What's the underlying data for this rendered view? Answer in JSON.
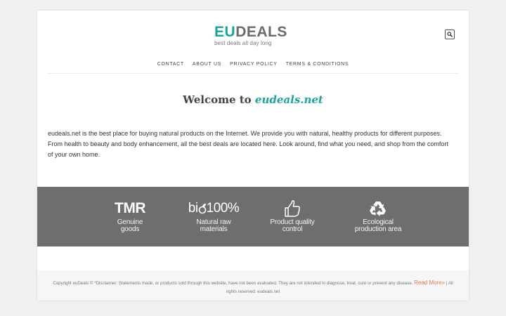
{
  "header": {
    "logo_prefix": "EU",
    "logo_suffix": "DEALS",
    "tagline": "best deals all day long",
    "search_icon": "search-icon"
  },
  "nav": {
    "items": [
      {
        "label": "CONTACT"
      },
      {
        "label": "ABOUT US"
      },
      {
        "label": "PRIVACY POLICY"
      },
      {
        "label": "TERMS & CONDITIONS"
      }
    ]
  },
  "main": {
    "welcome_prefix": "Welcome to",
    "welcome_brand": "eudeals.net",
    "intro": "eudeals.net is the best place for buying natural products on the Internet. We provide you with natural, healthy products for different purposes. From health to beauty and body enhancement, all the best deals are located here. Look around, find what you need, and shop from the comfort of your own home."
  },
  "features": [
    {
      "icon": "tmr-icon",
      "mark": "TMR",
      "line1": "Genuine",
      "line2": "goods"
    },
    {
      "icon": "bio-100-icon",
      "mark_a": "bi",
      "mark_b": "100%",
      "line1": "Natural raw",
      "line2": "materials"
    },
    {
      "icon": "thumbs-up-icon",
      "line1": "Product quality",
      "line2": "control"
    },
    {
      "icon": "recycle-icon",
      "line1": "Ecological",
      "line2": "production area"
    }
  ],
  "footer": {
    "copyright": "Copyright euDeals © *Disclaimer: Statements made, or products sold through this website, have not been evaluated. They are not intended to diagnose, treat, cure or prevent any disease.",
    "read_more": "Read More»",
    "rights": "| All rights reserved: eudeals.net"
  },
  "colors": {
    "accent": "#1aa59a",
    "logo_gray": "#6b6b6b",
    "band": "#6e6e6e",
    "link": "#e07a5a"
  }
}
